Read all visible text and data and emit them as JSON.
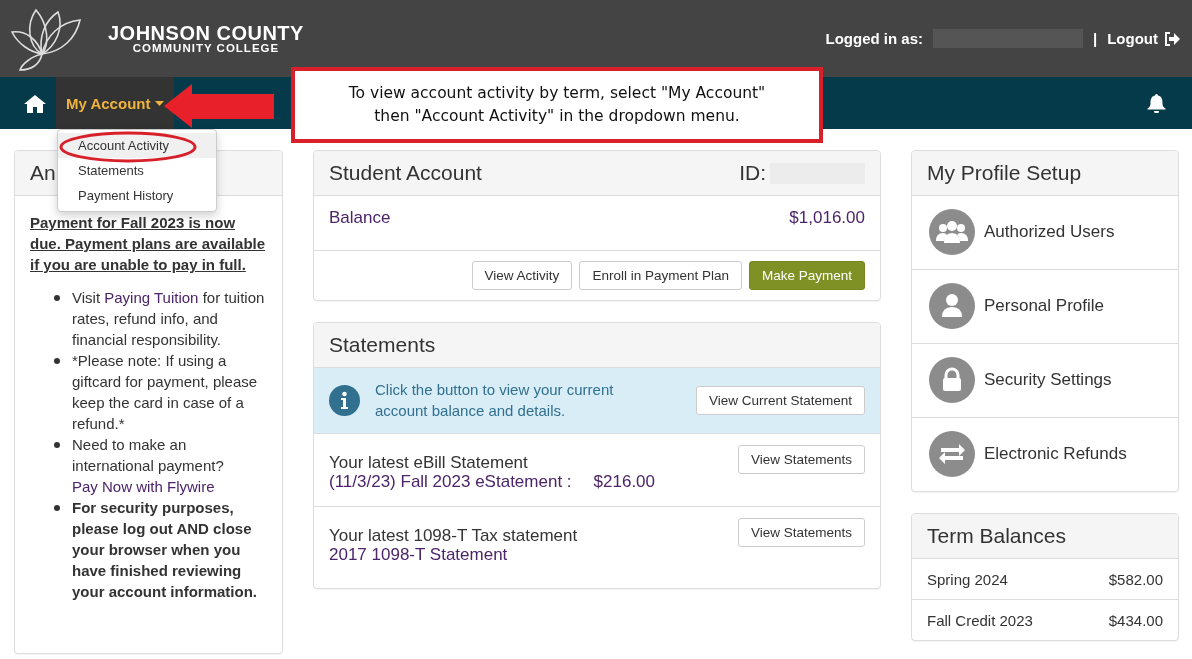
{
  "header": {
    "logo_line1": "JOHNSON COUNTY",
    "logo_line2": "COMMUNITY COLLEGE",
    "logged_in_label": "Logged in as:",
    "separator": "|",
    "logout": "Logout"
  },
  "nav": {
    "menu": "My Account",
    "expanded": true,
    "dropdown": [
      {
        "label": "Account Activity",
        "selected": true
      },
      {
        "label": "Statements",
        "selected": false
      },
      {
        "label": "Payment History",
        "selected": false
      }
    ]
  },
  "annotation": {
    "lines": [
      "To view account activity by term, select \"My Account\"",
      "then \"Account Activity\" in the dropdown menu."
    ]
  },
  "notice": {
    "title": "An",
    "headline": "Payment for Fall 2023 is now due.  Payment plans are available if you are unable to pay in full.",
    "items": [
      {
        "kind": "text",
        "parts": [
          {
            "text": "Visit "
          },
          {
            "link": "Paying Tuition"
          },
          {
            "text": " for tuition rates, refund info, and financial responsibility."
          }
        ]
      },
      {
        "kind": "text",
        "parts": [
          {
            "text": "*Please note: If using a giftcard for payment, please keep the card in case of a refund.*"
          }
        ]
      },
      {
        "kind": "text",
        "parts": [
          {
            "text": "Need to make an international payment? "
          },
          {
            "link": "Pay Now with Flywire"
          }
        ]
      },
      {
        "kind": "bold",
        "parts": [
          {
            "text": "For security purposes, please log out AND close your browser when you have finished reviewing your account information."
          }
        ]
      }
    ]
  },
  "student_account": {
    "title": "Student Account",
    "id_label": "ID:",
    "balance_label": "Balance",
    "balance": "$1,016.00",
    "buttons": [
      {
        "label": "View Activity",
        "kind": "default"
      },
      {
        "label": "Enroll in Payment Plan",
        "kind": "default"
      },
      {
        "label": "Make Payment",
        "kind": "primary"
      }
    ]
  },
  "statements": {
    "title": "Statements",
    "info": "Click the button to view your current account balance and details.",
    "info_button": "View Current Statement",
    "rows": [
      {
        "heading": "Your latest eBill Statement",
        "link": "(11/3/23) Fall 2023 eStatement :",
        "amount": "$216.00",
        "button": "View Statements"
      },
      {
        "heading": "Your latest 1098-T Tax statement",
        "link": "2017 1098-T Statement",
        "button": "View Statements"
      }
    ]
  },
  "profile": {
    "title": "My Profile Setup",
    "items": [
      {
        "label": "Authorized Users",
        "kind": "users"
      },
      {
        "label": "Personal Profile",
        "kind": "person"
      },
      {
        "label": "Security Settings",
        "kind": "lock"
      },
      {
        "label": "Electronic Refunds",
        "kind": "exchange"
      }
    ]
  },
  "term_balances": {
    "title": "Term Balances",
    "rows": [
      {
        "term": "Spring 2024",
        "amount": "$582.00"
      },
      {
        "term": "Fall Credit 2023",
        "amount": "$434.00"
      }
    ]
  }
}
